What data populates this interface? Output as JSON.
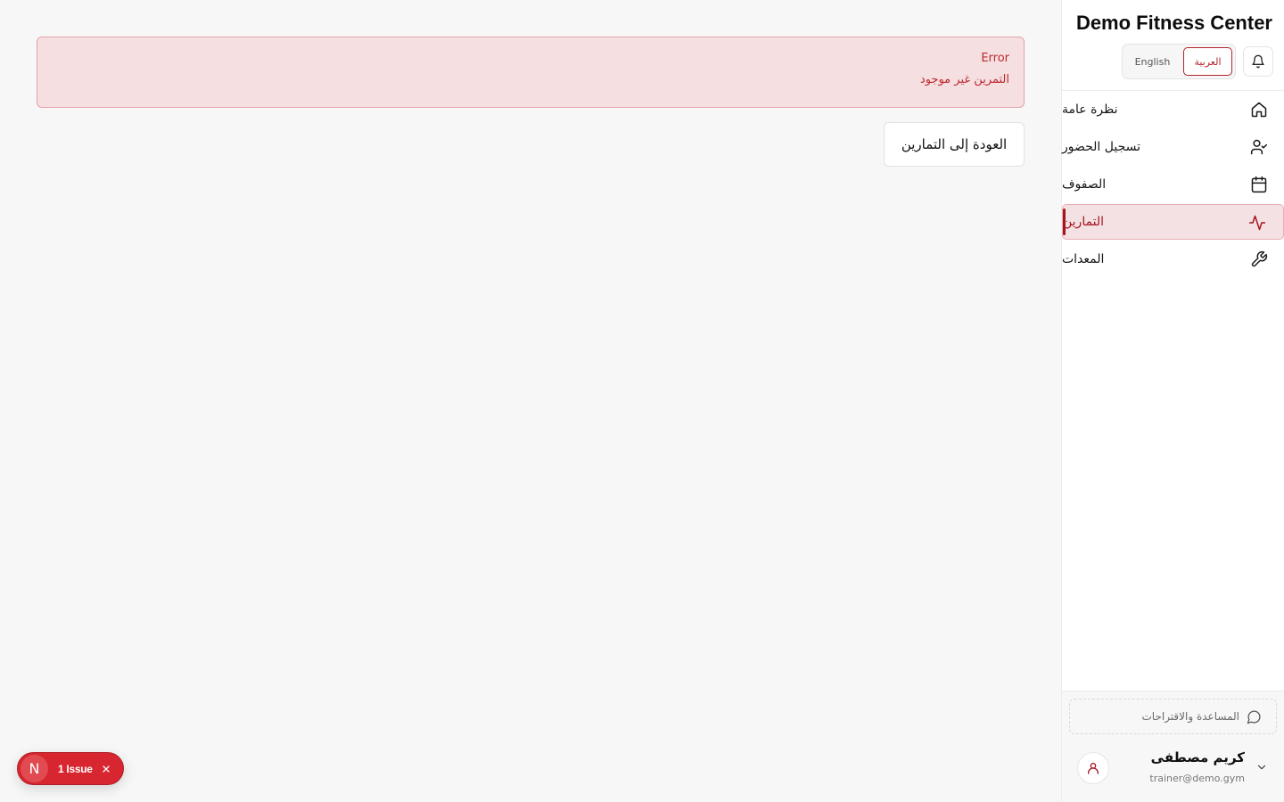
{
  "main": {
    "error": {
      "title": "Error",
      "message": "التمرين غير موجود"
    },
    "back_button": "العودة إلى التمارين"
  },
  "sidebar": {
    "brand": "Demo Fitness Center",
    "languages": {
      "english": "English",
      "arabic": "العربية",
      "selected": "العربية"
    },
    "nav": [
      {
        "label": "نظرة عامة",
        "icon": "home-icon"
      },
      {
        "label": "تسجيل الحضور",
        "icon": "user-check-icon"
      },
      {
        "label": "الصفوف",
        "icon": "calendar-icon"
      },
      {
        "label": "التمارين",
        "icon": "activity-icon",
        "active": true
      },
      {
        "label": "المعدات",
        "icon": "wrench-icon"
      }
    ],
    "help": "المساعدة والاقتراحات",
    "user": {
      "name": "كريم مصطفى",
      "email": "trainer@demo.gym"
    }
  },
  "issue_badge": {
    "logo": "N",
    "label": "1 Issue"
  },
  "colors": {
    "accent": "#a5141f",
    "error_bg": "#f5dfe0",
    "error_text": "#c0282f",
    "issue_badge": "#d7262f"
  }
}
